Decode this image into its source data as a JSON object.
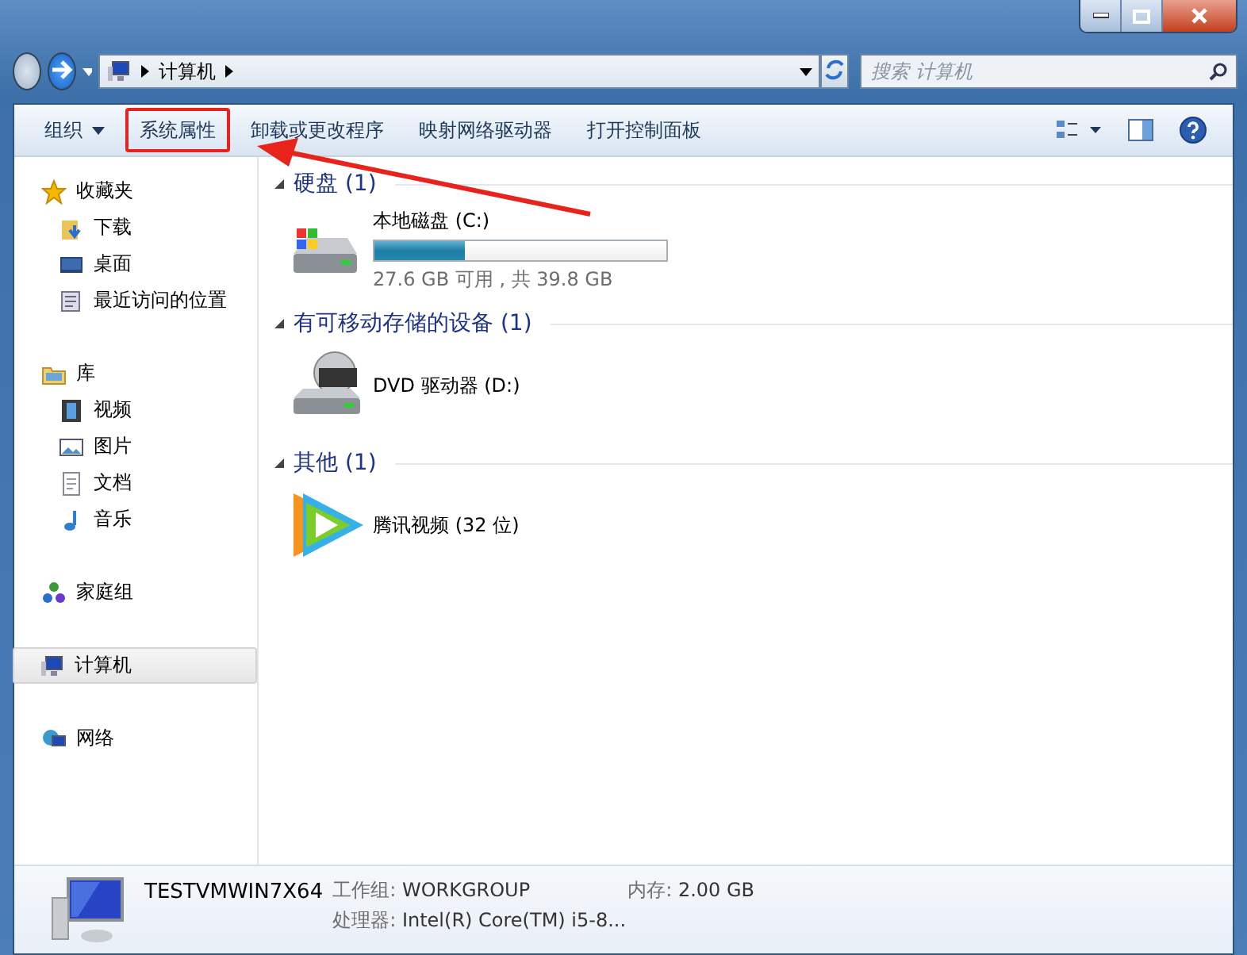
{
  "address": {
    "path": [
      "计算机"
    ]
  },
  "search": {
    "placeholder": "搜索 计算机"
  },
  "toolbar": {
    "items": [
      {
        "label": "组织",
        "kind": "menu",
        "highlighted": false
      },
      {
        "label": "系统属性",
        "kind": "command",
        "highlighted": true
      },
      {
        "label": "卸载或更改程序",
        "kind": "command",
        "highlighted": false
      },
      {
        "label": "映射网络驱动器",
        "kind": "command",
        "highlighted": false
      },
      {
        "label": "打开控制面板",
        "kind": "command",
        "highlighted": false
      }
    ]
  },
  "sidebar": {
    "groups": [
      {
        "label": "收藏夹",
        "kind": "star",
        "selected": false,
        "children": [
          {
            "label": "下载",
            "kind": "download",
            "selected": false
          },
          {
            "label": "桌面",
            "kind": "desktop",
            "selected": false
          },
          {
            "label": "最近访问的位置",
            "kind": "recent",
            "selected": false
          }
        ]
      },
      {
        "label": "库",
        "kind": "library",
        "selected": false,
        "children": [
          {
            "label": "视频",
            "kind": "video",
            "selected": false
          },
          {
            "label": "图片",
            "kind": "picture",
            "selected": false
          },
          {
            "label": "文档",
            "kind": "document",
            "selected": false
          },
          {
            "label": "音乐",
            "kind": "music",
            "selected": false
          }
        ]
      },
      {
        "label": "家庭组",
        "kind": "homegroup",
        "selected": false
      },
      {
        "label": "计算机",
        "kind": "computer",
        "selected": true
      },
      {
        "label": "网络",
        "kind": "network",
        "selected": false
      }
    ]
  },
  "sections": [
    {
      "title": "硬盘 (1)",
      "items": [
        {
          "name": "本地磁盘 (C:)",
          "kind": "drive",
          "level": 0.31,
          "free_text": "27.6 GB 可用 , 共 39.8 GB"
        }
      ]
    },
    {
      "title": "有可移动存储的设备 (1)",
      "items": [
        {
          "name": "DVD 驱动器 (D:)",
          "kind": "dvd"
        }
      ]
    },
    {
      "title": "其他 (1)",
      "items": [
        {
          "name": "腾讯视频 (32 位)",
          "kind": "app"
        }
      ]
    }
  ],
  "details": {
    "computer_name": "TESTVMWIN7X64",
    "fields": [
      {
        "label": "工作组:",
        "value": "WORKGROUP"
      },
      {
        "label": "内存:",
        "value": "2.00 GB"
      },
      {
        "label": "处理器:",
        "value": "Intel(R) Core(TM) i5-8..."
      }
    ]
  }
}
